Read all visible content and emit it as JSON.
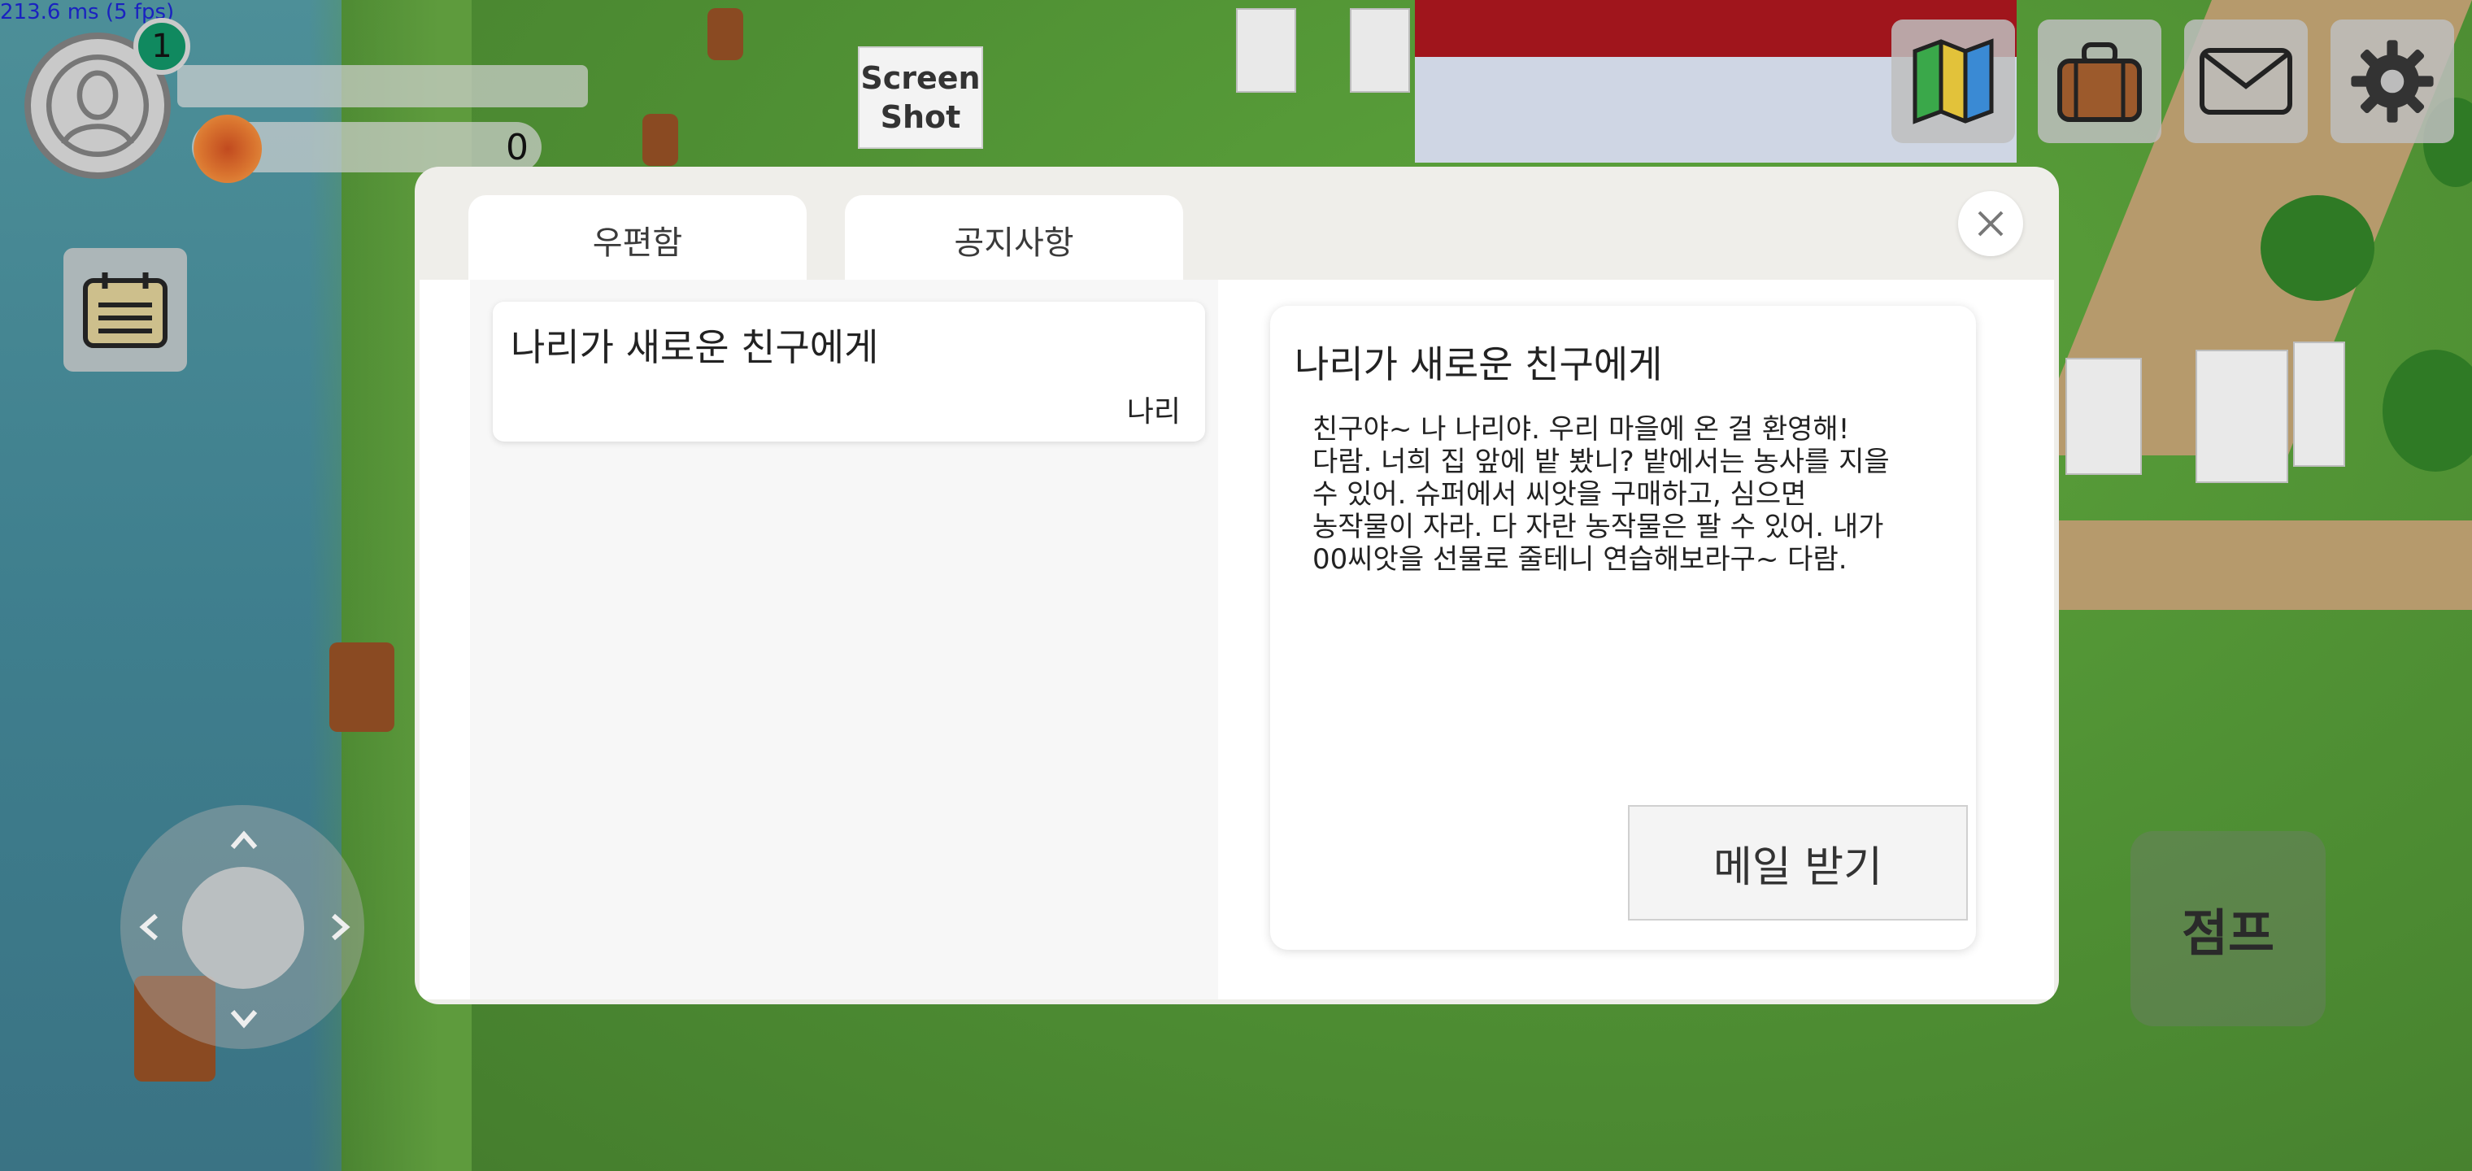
{
  "hud": {
    "fps_text": "213.6 ms (5 fps)",
    "level": "1",
    "coins": "0",
    "screenshot_label": "Screen\nShot",
    "jump_label": "점프",
    "top_buttons": [
      {
        "icon": "map-icon"
      },
      {
        "icon": "bag-icon"
      },
      {
        "icon": "mail-icon"
      },
      {
        "icon": "gear-icon"
      }
    ]
  },
  "mail_dialog": {
    "tabs": [
      {
        "label": "우편함"
      },
      {
        "label": "공지사항"
      }
    ],
    "list": [
      {
        "title": "나리가 새로운 친구에게",
        "sender": "나리"
      }
    ],
    "detail": {
      "title": "나리가 새로운 친구에게",
      "body": "친구야~ 나 나리야. 우리 마을에 온 걸 환영해!\n다람. 너희 집 앞에 밭 봤니? 밭에서는 농사를 지을\n수 있어. 슈퍼에서 씨앗을 구매하고, 심으면\n농작물이 자라. 다 자란 농작물은 팔 수 있어. 내가\n00씨앗을 선물로 줄테니 연습해보라구~ 다람.",
      "receive_label": "메일 받기"
    }
  },
  "colors": {
    "level_badge": "#10895f",
    "grass": "#4f8d33",
    "water": "#3f7f8e",
    "dialog_bg": "#efeeea"
  }
}
